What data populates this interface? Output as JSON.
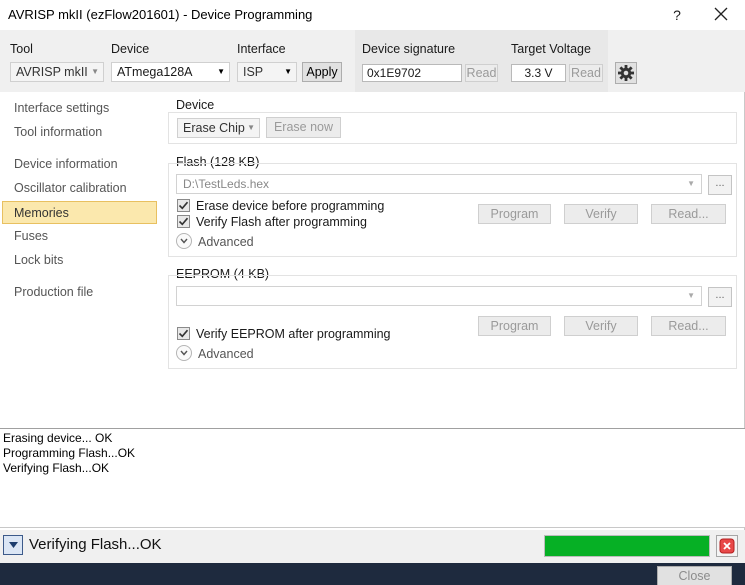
{
  "window": {
    "title": "AVRISP mkII (ezFlow201601) - Device Programming",
    "help": "?",
    "close_button": "Close"
  },
  "toolbar": {
    "tool_label": "Tool",
    "tool_value": "AVRISP mkII",
    "device_label": "Device",
    "device_value": "ATmega128A",
    "interface_label": "Interface",
    "interface_value": "ISP",
    "apply": "Apply",
    "signature_label": "Device signature",
    "signature_value": "0x1E9702",
    "signature_read": "Read",
    "voltage_label": "Target Voltage",
    "voltage_value": "3.3 V",
    "voltage_read": "Read",
    "settings_icon": "gear-icon"
  },
  "sidebar": {
    "items": [
      "Interface settings",
      "Tool information",
      "Device information",
      "Oscillator calibration",
      "Memories",
      "Fuses",
      "Lock bits",
      "Production file"
    ],
    "active": "Memories",
    "active_color": "#fbe8ad"
  },
  "device_section": {
    "label": "Device",
    "erase_mode": "Erase Chip",
    "erase_now": "Erase now"
  },
  "flash": {
    "label": "Flash (128 KB)",
    "file_path": "D:\\TestLeds.hex",
    "browse": "...",
    "erase_before": "Erase device before programming",
    "verify_after": "Verify Flash after programming",
    "program": "Program",
    "verify": "Verify",
    "read": "Read...",
    "advanced": "Advanced"
  },
  "eeprom": {
    "label": "EEPROM (4 KB)",
    "file_path": "",
    "browse": "...",
    "verify_after": "Verify EEPROM after programming",
    "program": "Program",
    "verify": "Verify",
    "read": "Read...",
    "advanced": "Advanced"
  },
  "log": {
    "lines": [
      "Erasing device... OK",
      "Programming Flash...OK",
      "Verifying Flash...OK"
    ]
  },
  "status": {
    "text": "Verifying Flash...OK",
    "progress": 1.0,
    "progress_color": "#06b025"
  }
}
